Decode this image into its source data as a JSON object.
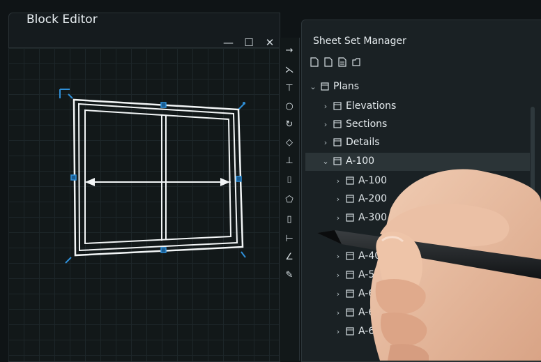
{
  "block_editor": {
    "title": "Block Editor",
    "controls": {
      "minimize": "—",
      "maximize": "☐",
      "close": "✕"
    }
  },
  "toolstrip": {
    "tools": [
      "arrow-icon",
      "angle-icon",
      "dimension-icon",
      "circle-icon",
      "rotate-icon",
      "diamond-icon",
      "snap-icon",
      "insert-icon",
      "tag-icon",
      "rectangle-icon",
      "line-icon",
      "angle-measure-icon",
      "pen-icon"
    ]
  },
  "sheet_set_manager": {
    "title": "Sheet Set Manager",
    "toolbar_icons": [
      "new-sheet-icon",
      "sheet-icon",
      "document-icon",
      "folder-icon"
    ],
    "tree": [
      {
        "label": "Plans",
        "level": 0,
        "expanded": true
      },
      {
        "label": "Elevations",
        "level": 1
      },
      {
        "label": "Sections",
        "level": 1
      },
      {
        "label": "Details",
        "level": 1
      },
      {
        "label": "A-100",
        "level": 1,
        "expanded": true,
        "selected": true
      },
      {
        "label": "A-100",
        "level": 2
      },
      {
        "label": "A-200",
        "level": 2
      },
      {
        "label": "A-300",
        "level": 2
      },
      {
        "label": "A-400",
        "level": 2
      },
      {
        "label": "A-500",
        "level": 2
      },
      {
        "label": "A-600",
        "level": 2
      },
      {
        "label": "A-600",
        "level": 2
      },
      {
        "label": "A-600",
        "level": 2
      }
    ]
  },
  "colors": {
    "accent": "#2f8fd8",
    "panel": "#1a2124",
    "selection": "#2b3437"
  }
}
